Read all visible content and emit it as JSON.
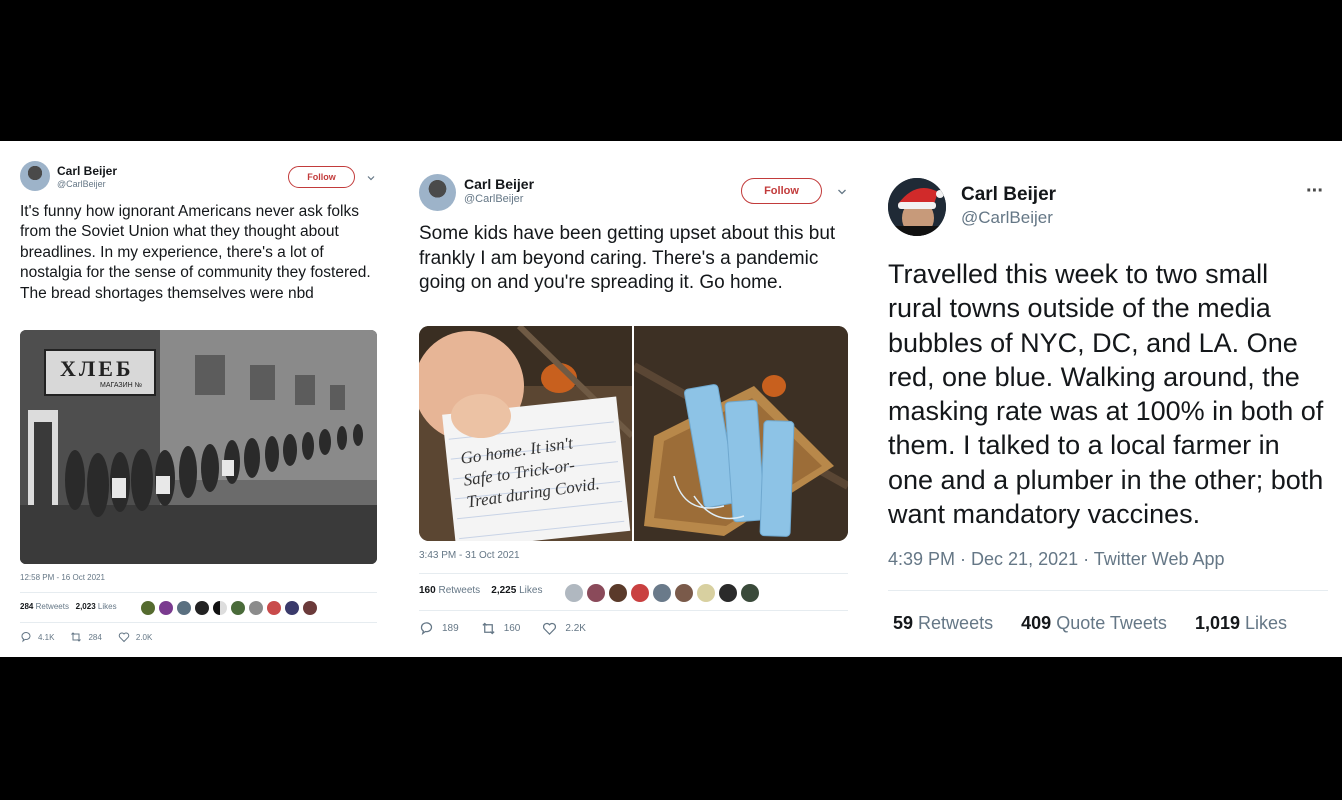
{
  "tweets": [
    {
      "name": "Carl Beijer",
      "handle": "@CarlBeijer",
      "follow_label": "Follow",
      "text": "It's funny how ignorant Americans never ask folks from the Soviet Union what they thought about breadlines. In my experience, there's a lot of nostalgia for the sense of community they fostered. The bread shortages themselves were nbd",
      "image_sign": "ХЛЕБ",
      "image_subsign": "МАГАЗИН №",
      "timestamp": "12:58 PM - 16 Oct 2021",
      "retweets_count": "284",
      "retweets_label": "Retweets",
      "likes_count": "2,023",
      "likes_label": "Likes",
      "replies": "4.1K",
      "retweets_action": "284",
      "likes_action": "2.0K"
    },
    {
      "name": "Carl Beijer",
      "handle": "@CarlBeijer",
      "follow_label": "Follow",
      "text": "Some kids have been getting upset about this but frankly I am beyond caring. There's a pandemic going on and you're spreading it. Go home.",
      "note_text": "Go home. It isn't Safe to Trick-or-Treat during Covid.",
      "timestamp": "3:43 PM - 31 Oct 2021",
      "retweets_count": "160",
      "retweets_label": "Retweets",
      "likes_count": "2,225",
      "likes_label": "Likes",
      "replies": "189",
      "retweets_action": "160",
      "likes_action": "2.2K"
    },
    {
      "name": "Carl Beijer",
      "handle": "@CarlBeijer",
      "more_label": "···",
      "text": "Travelled this week to two small rural towns outside of the media bubbles of NYC, DC, and LA. One red, one blue. Walking around, the masking rate was at 100% in both of them. I talked to a local farmer in one and a plumber in the other; both want mandatory vaccines.",
      "timestamp": "4:39 PM · Dec 21, 2021 · Twitter Web App",
      "retweets_count": "59",
      "retweets_label": "Retweets",
      "quotes_count": "409",
      "quotes_label": "Quote Tweets",
      "likes_count": "1,019",
      "likes_label": "Likes"
    }
  ],
  "icons": [
    "reply-icon",
    "retweet-icon",
    "like-icon",
    "chevron-down-icon",
    "more-icon"
  ],
  "colors": {
    "follow_accent": "#c23b3b",
    "muted": "#657786",
    "text": "#14171a"
  }
}
